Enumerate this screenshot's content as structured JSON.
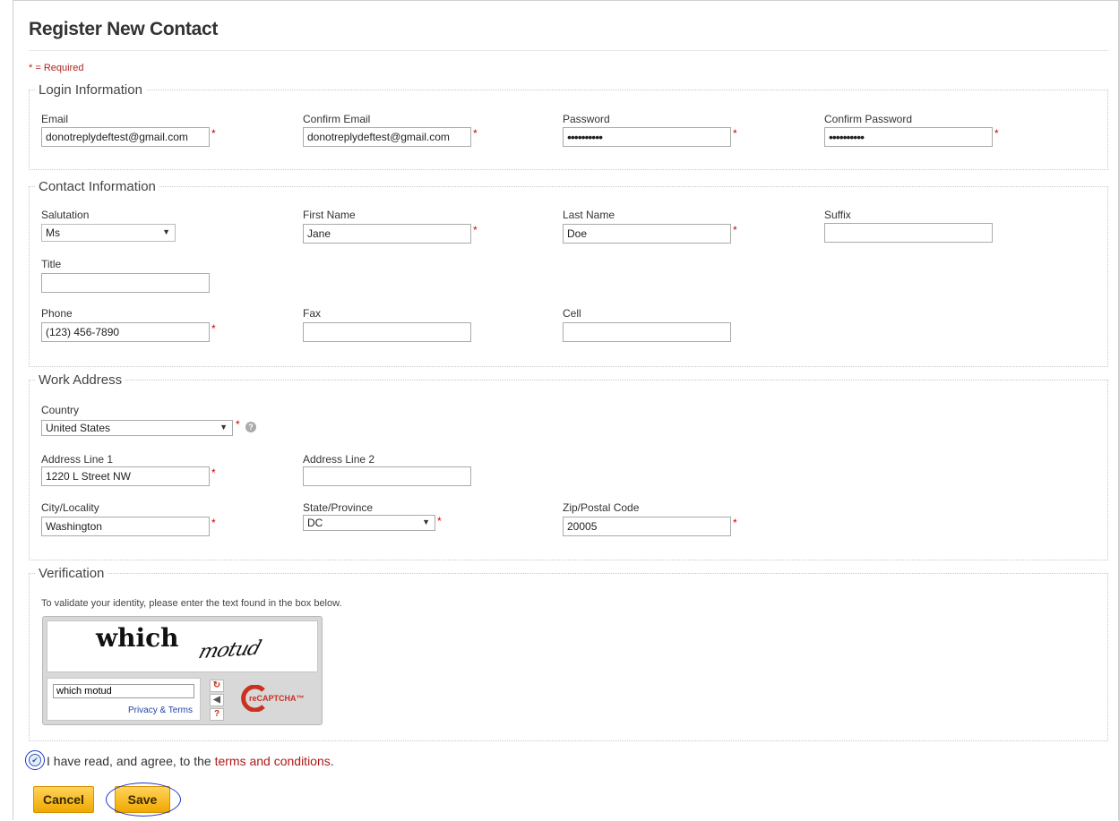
{
  "page": {
    "title": "Register New Contact",
    "required_note": "* = Required"
  },
  "login": {
    "legend": "Login Information",
    "email_label": "Email",
    "email_value": "donotreplydeftest@gmail.com",
    "confirm_email_label": "Confirm Email",
    "confirm_email_value": "donotreplydeftest@gmail.com",
    "password_label": "Password",
    "password_value": "••••••••••",
    "confirm_password_label": "Confirm Password",
    "confirm_password_value": "••••••••••"
  },
  "contact": {
    "legend": "Contact Information",
    "salutation_label": "Salutation",
    "salutation_value": "Ms",
    "first_name_label": "First Name",
    "first_name_value": "Jane",
    "last_name_label": "Last Name",
    "last_name_value": "Doe",
    "suffix_label": "Suffix",
    "suffix_value": "",
    "title_label": "Title",
    "title_value": "",
    "phone_label": "Phone",
    "phone_value": "(123) 456-7890",
    "fax_label": "Fax",
    "fax_value": "",
    "cell_label": "Cell",
    "cell_value": ""
  },
  "address": {
    "legend": "Work Address",
    "country_label": "Country",
    "country_value": "United States",
    "line1_label": "Address Line 1",
    "line1_value": "1220 L Street NW",
    "line2_label": "Address Line 2",
    "line2_value": "",
    "city_label": "City/Locality",
    "city_value": "Washington",
    "state_label": "State/Province",
    "state_value": "DC",
    "zip_label": "Zip/Postal Code",
    "zip_value": "20005"
  },
  "verification": {
    "legend": "Verification",
    "instructions": "To validate your identity, please enter the text found in the box below.",
    "captcha_word1": "which",
    "captcha_word2": "motud",
    "captcha_input_value": "which motud",
    "privacy_link": "Privacy & Terms",
    "brand": "reCAPTCHA™"
  },
  "agreement": {
    "checked": true,
    "text": "I have read, and agree, to the ",
    "link_text": "terms and conditions",
    "suffix": "."
  },
  "buttons": {
    "cancel": "Cancel",
    "save": "Save"
  },
  "marks": {
    "required": "*",
    "help": "?",
    "dropdown": "▼",
    "checkmark": "✔",
    "refresh": "↻",
    "audio": "◀",
    "question": "?"
  },
  "colors": {
    "required": "#cc0000",
    "link": "#b01818",
    "button": "#f0a800",
    "annotation": "#2233cc"
  },
  "icons": [
    "help-icon",
    "refresh-icon",
    "audio-icon",
    "help-question-icon",
    "recaptcha-logo-icon",
    "checkmark-icon"
  ]
}
